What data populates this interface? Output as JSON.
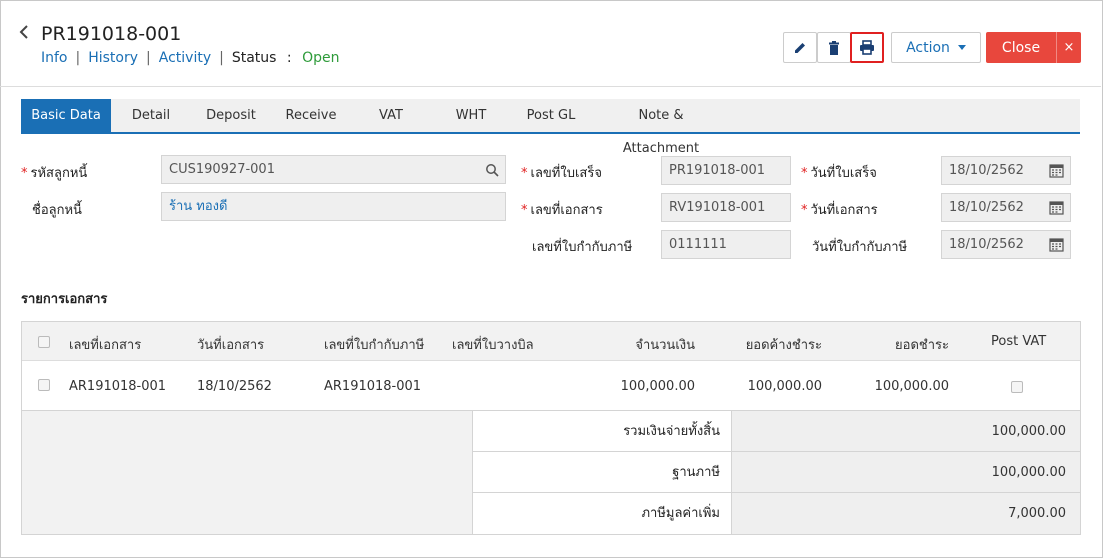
{
  "header": {
    "title": "PR191018-001",
    "links": [
      "Info",
      "History",
      "Activity"
    ],
    "status_label": "Status",
    "status_colon": ":",
    "status_value": "Open"
  },
  "toolbar": {
    "action_label": "Action",
    "close_label": "Close",
    "close_x": "×"
  },
  "tabs": [
    "Basic Data",
    "Detail",
    "Deposit",
    "Receive",
    "VAT",
    "WHT",
    "Post GL",
    "Note & Attachment"
  ],
  "form": {
    "customer_code_label": "รหัสลูกหนี้",
    "customer_code_value": "CUS190927-001",
    "customer_name_label": "ชื่อลูกหนี้",
    "customer_name_value": "ร้าน ทองดี",
    "receipt_no_label": "เลขที่ใบเสร็จ",
    "receipt_no_value": "PR191018-001",
    "doc_no_label": "เลขที่เอกสาร",
    "doc_no_value": "RV191018-001",
    "tax_invoice_no_label": "เลขที่ใบกำกับภาษี",
    "tax_invoice_no_value": "0111111",
    "receipt_date_label": "วันที่ใบเสร็จ",
    "receipt_date_value": "18/10/2562",
    "doc_date_label": "วันที่เอกสาร",
    "doc_date_value": "18/10/2562",
    "tax_invoice_date_label": "วันที่ใบกำกับภาษี",
    "tax_invoice_date_value": "18/10/2562"
  },
  "section_title": "รายการเอกสาร",
  "table": {
    "columns": [
      "เลขที่เอกสาร",
      "วันที่เอกสาร",
      "เลขที่ใบกำกับภาษี",
      "เลขที่ใบวางบิล",
      "จำนวนเงิน",
      "ยอดค้างชำระ",
      "ยอดชำระ",
      "Post VAT"
    ],
    "rows": [
      [
        "AR191018-001",
        "18/10/2562",
        "AR191018-001",
        "",
        "100,000.00",
        "100,000.00",
        "100,000.00"
      ]
    ]
  },
  "summary": [
    {
      "label": "รวมเงินจ่ายทั้งสิ้น",
      "value": "100,000.00"
    },
    {
      "label": "ฐานภาษี",
      "value": "100,000.00"
    },
    {
      "label": "ภาษีมูลค่าเพิ่ม",
      "value": "7,000.00"
    }
  ]
}
